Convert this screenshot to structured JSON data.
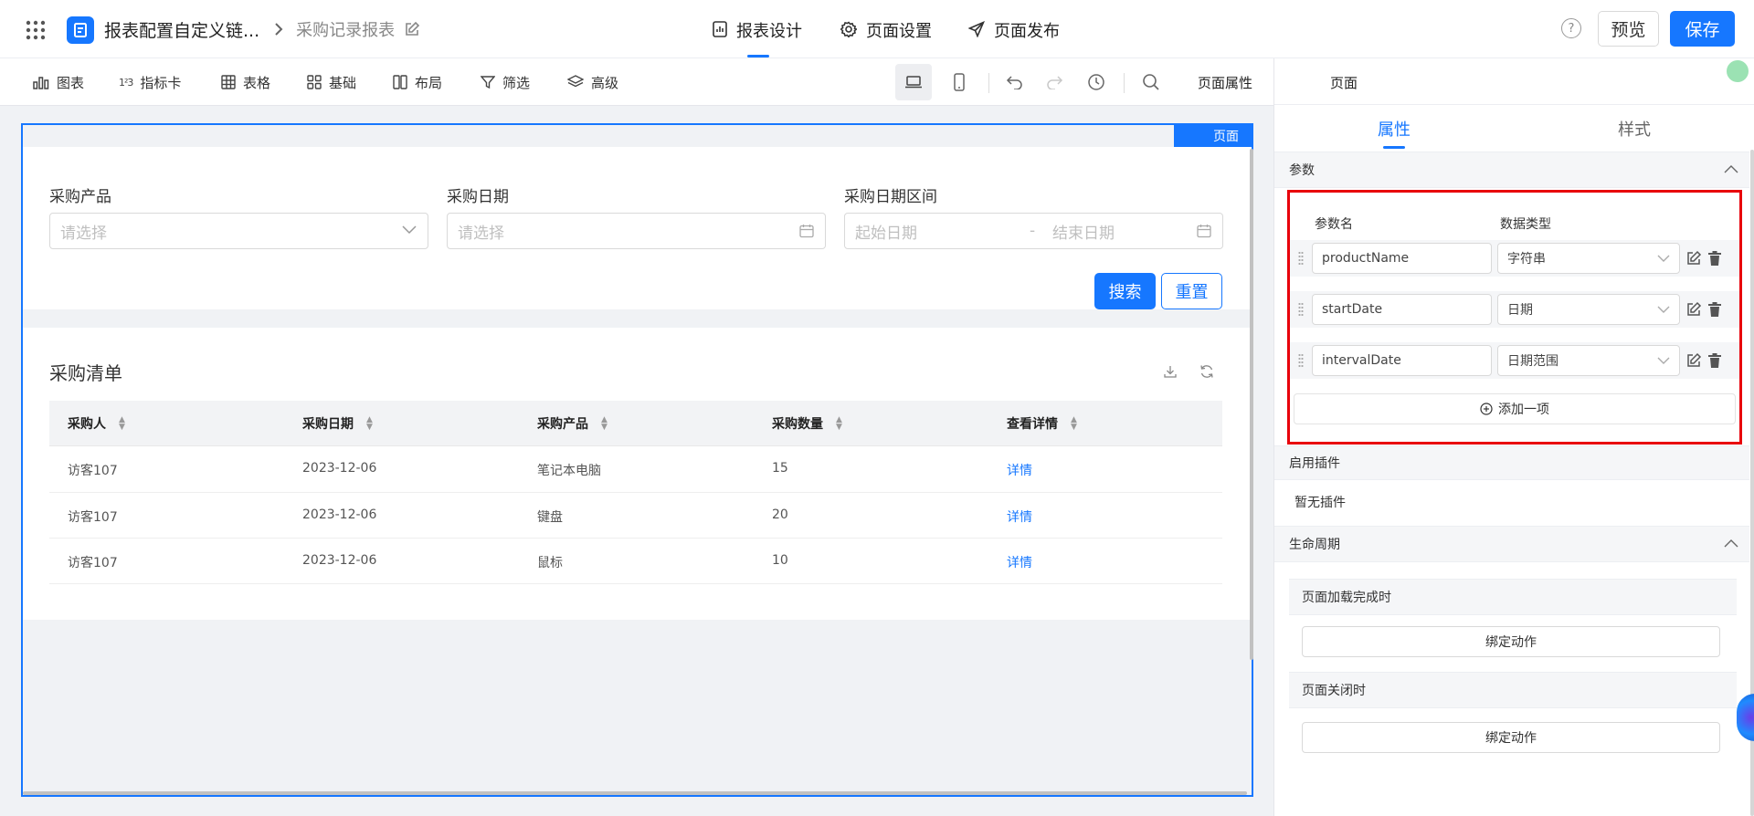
{
  "header": {
    "breadcrumb_root": "报表配置自定义链...",
    "current_page": "采购记录报表",
    "tabs": [
      {
        "label": "报表设计",
        "icon": "report-icon",
        "active": true
      },
      {
        "label": "页面设置",
        "icon": "gear-icon",
        "active": false
      },
      {
        "label": "页面发布",
        "icon": "send-icon",
        "active": false
      }
    ],
    "preview_label": "预览",
    "save_label": "保存"
  },
  "toolbar": {
    "items": [
      {
        "label": "图表",
        "icon": "bar-chart-icon"
      },
      {
        "label": "指标卡",
        "icon": "number-icon"
      },
      {
        "label": "表格",
        "icon": "table-icon"
      },
      {
        "label": "基础",
        "icon": "grid-icon"
      },
      {
        "label": "布局",
        "icon": "layout-icon"
      },
      {
        "label": "筛选",
        "icon": "filter-icon"
      },
      {
        "label": "高级",
        "icon": "layers-icon"
      }
    ],
    "page_props_label": "页面属性"
  },
  "canvas": {
    "page_tag": "页面",
    "filters": {
      "product_label": "采购产品",
      "product_placeholder": "请选择",
      "date_label": "采购日期",
      "date_placeholder": "请选择",
      "range_label": "采购日期区间",
      "range_start_placeholder": "起始日期",
      "range_separator": "-",
      "range_end_placeholder": "结束日期",
      "search_label": "搜索",
      "reset_label": "重置"
    },
    "table": {
      "title": "采购清单",
      "columns": [
        "采购人",
        "采购日期",
        "采购产品",
        "采购数量",
        "查看详情"
      ],
      "rows": [
        [
          "访客107",
          "2023-12-06",
          "笔记本电脑",
          "15",
          "详情"
        ],
        [
          "访客107",
          "2023-12-06",
          "键盘",
          "20",
          "详情"
        ],
        [
          "访客107",
          "2023-12-06",
          "鼠标",
          "10",
          "详情"
        ]
      ]
    }
  },
  "panel": {
    "title": "页面",
    "tabs": [
      "属性",
      "样式"
    ],
    "params_section": "参数",
    "param_name_header": "参数名",
    "param_type_header": "数据类型",
    "params": [
      {
        "name": "productName",
        "type": "字符串"
      },
      {
        "name": "startDate",
        "type": "日期"
      },
      {
        "name": "intervalDate",
        "type": "日期范围"
      }
    ],
    "add_item_label": "添加一项",
    "plugins_section": "启用插件",
    "no_plugins": "暂无插件",
    "lifecycle_section": "生命周期",
    "on_load_label": "页面加载完成时",
    "on_close_label": "页面关闭时",
    "bind_action_label": "绑定动作"
  },
  "colors": {
    "accent": "#1677ff",
    "highlight_border": "#e8000b",
    "status_dot": "#9be2b3"
  }
}
